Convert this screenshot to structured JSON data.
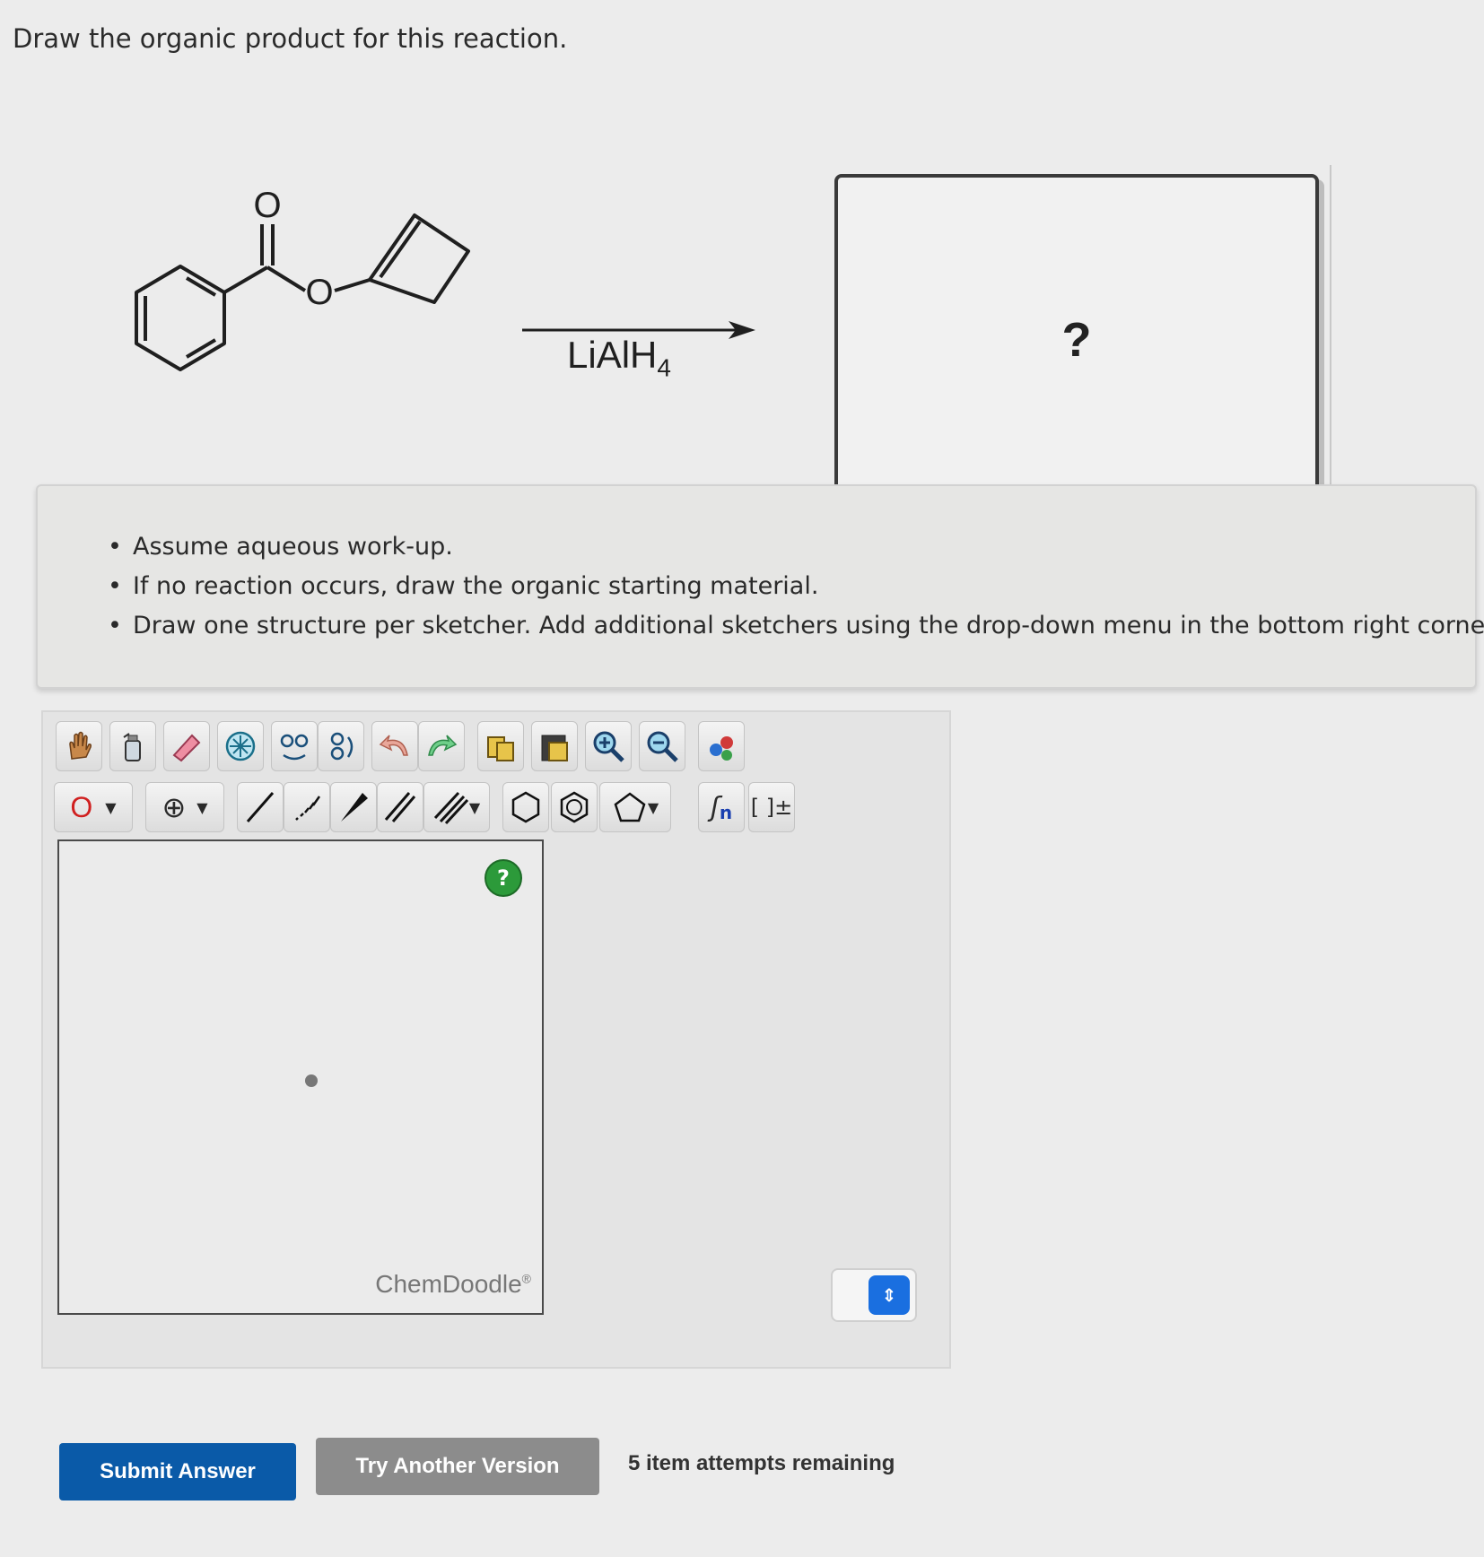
{
  "question": {
    "prompt": "Draw the organic product for this reaction."
  },
  "reaction": {
    "reactant_atoms": {
      "carbonyl_oxygen": "O",
      "ester_oxygen": "O"
    },
    "reagent": "LiAlH",
    "reagent_subscript": "4",
    "product_placeholder": "?"
  },
  "instructions": [
    "Assume aqueous work-up.",
    "If no reaction occurs, draw the organic starting material.",
    "Draw one structure per sketcher. Add additional sketchers using the drop-down menu in the bottom right corner."
  ],
  "sketcher": {
    "toolbar_row1": [
      "hand-icon",
      "clear-icon",
      "eraser-icon",
      "center-icon",
      "flip-icon",
      "rotate-icon",
      "undo-icon",
      "redo-icon",
      "copy-icon",
      "paste-icon",
      "zoom-in-icon",
      "zoom-out-icon",
      "atom-color-icon"
    ],
    "toolbar_row2": {
      "element_label": "O",
      "charge_symbol": "⊕",
      "bond_tools": [
        "single-bond-icon",
        "hash-bond-icon",
        "wedge-bond-icon",
        "double-bond-icon",
        "triple-bond-icon"
      ],
      "ring_tools": [
        "cyclohexane-icon",
        "benzene-icon",
        "cyclopentane-icon"
      ],
      "repeat_label": "n",
      "bracket_label": "[ ]±"
    },
    "help": "?",
    "watermark": "ChemDoodle",
    "watermark_mark": "®"
  },
  "buttons": {
    "submit": "Submit Answer",
    "try_another": "Try Another Version"
  },
  "attempts": "5 item attempts remaining",
  "colors": {
    "submit": "#0a5aa8",
    "try": "#8c8c8c",
    "help": "#2c9a3a",
    "stepper": "#1a6fe0",
    "element_red": "#d02020"
  }
}
